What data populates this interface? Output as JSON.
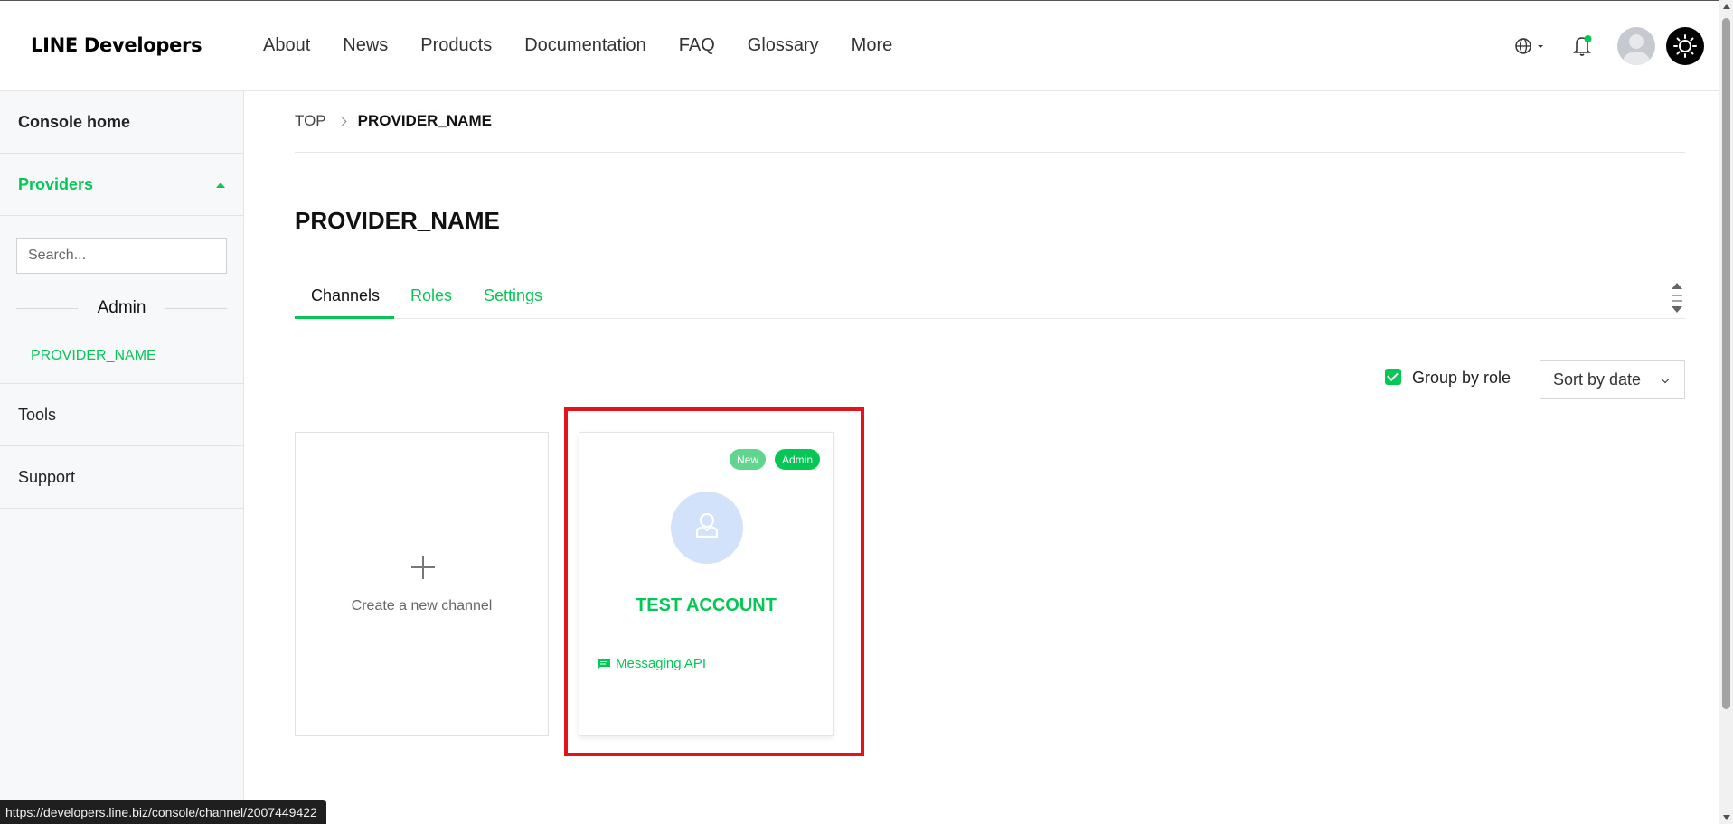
{
  "header": {
    "logo": "LINE Developers",
    "nav": [
      "About",
      "News",
      "Products",
      "Documentation",
      "FAQ",
      "Glossary",
      "More"
    ]
  },
  "sidebar": {
    "console_home": "Console home",
    "providers": "Providers",
    "search_placeholder": "Search...",
    "admin_label": "Admin",
    "provider_link": "PROVIDER_NAME",
    "tools": "Tools",
    "support": "Support"
  },
  "breadcrumb": {
    "top": "TOP",
    "current": "PROVIDER_NAME"
  },
  "page_title": "PROVIDER_NAME",
  "tabs": {
    "channels": "Channels",
    "roles": "Roles",
    "settings": "Settings"
  },
  "controls": {
    "group_by_role": "Group by role",
    "group_by_checked": true,
    "sort_value": "Sort by date"
  },
  "cards": {
    "create_label": "Create a new channel",
    "channel": {
      "badge_new": "New",
      "badge_admin": "Admin",
      "name": "TEST ACCOUNT",
      "type": "Messaging API"
    }
  },
  "status_url": "https://developers.line.biz/console/channel/2007449422",
  "colors": {
    "accent": "#06c755",
    "highlight": "#e4121b"
  },
  "icons": {
    "language": "globe-icon",
    "notifications": "bell-icon",
    "theme": "sun-icon"
  }
}
